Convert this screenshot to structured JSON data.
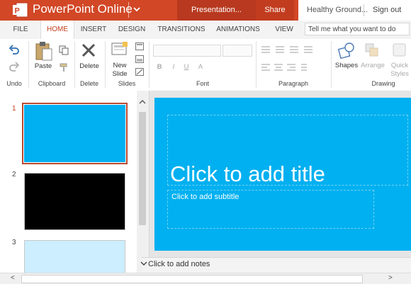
{
  "app": {
    "title": "PowerPoint Online",
    "file_name": "Presentation...",
    "share_label": "Share",
    "user": "Healthy Ground...",
    "sign_out": "Sign out"
  },
  "tabs": [
    "FILE",
    "HOME",
    "INSERT",
    "DESIGN",
    "TRANSITIONS",
    "ANIMATIONS",
    "VIEW"
  ],
  "active_tab": "HOME",
  "tell_me": {
    "placeholder": "Tell me what you want to do"
  },
  "ribbon": {
    "groups": [
      "Undo",
      "Clipboard",
      "Delete",
      "Slides",
      "Font",
      "Paragraph",
      "Drawing"
    ],
    "buttons": {
      "paste": "Paste",
      "delete": "Delete",
      "new_slide_line1": "New",
      "new_slide_line2": "Slide",
      "shapes": "Shapes",
      "arrange": "Arrange",
      "quick_styles_line1": "Quick",
      "quick_styles_line2": "Styles"
    },
    "font_buttons": [
      "B",
      "I",
      "U",
      "A"
    ]
  },
  "thumbnails": [
    {
      "number": "1",
      "color": "#00b0f0"
    },
    {
      "number": "2",
      "color": "#000000"
    },
    {
      "number": "3",
      "color": "#cceeff"
    }
  ],
  "slide": {
    "background": "#00b0f0",
    "title_placeholder": "Click to add title",
    "subtitle_placeholder": "Click to add subtitle"
  },
  "notes": {
    "placeholder": "Click to add notes"
  },
  "colors": {
    "brand": "#d24726",
    "accent_text": "#c43e1c",
    "slide": "#00b0f0"
  }
}
